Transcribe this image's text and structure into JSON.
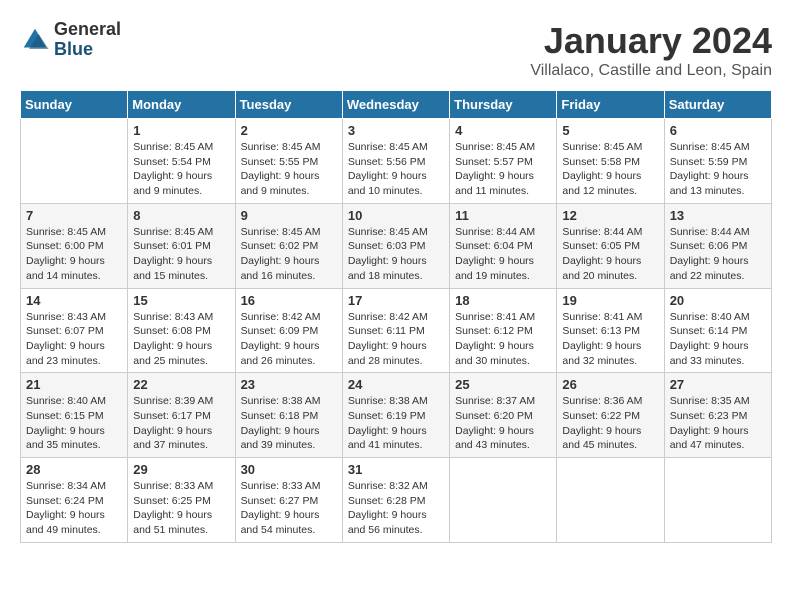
{
  "logo": {
    "general": "General",
    "blue": "Blue"
  },
  "title": "January 2024",
  "subtitle": "Villalaco, Castille and Leon, Spain",
  "days_of_week": [
    "Sunday",
    "Monday",
    "Tuesday",
    "Wednesday",
    "Thursday",
    "Friday",
    "Saturday"
  ],
  "weeks": [
    [
      {
        "day": "",
        "sunrise": "",
        "sunset": "",
        "daylight": ""
      },
      {
        "day": "1",
        "sunrise": "Sunrise: 8:45 AM",
        "sunset": "Sunset: 5:54 PM",
        "daylight": "Daylight: 9 hours and 9 minutes."
      },
      {
        "day": "2",
        "sunrise": "Sunrise: 8:45 AM",
        "sunset": "Sunset: 5:55 PM",
        "daylight": "Daylight: 9 hours and 9 minutes."
      },
      {
        "day": "3",
        "sunrise": "Sunrise: 8:45 AM",
        "sunset": "Sunset: 5:56 PM",
        "daylight": "Daylight: 9 hours and 10 minutes."
      },
      {
        "day": "4",
        "sunrise": "Sunrise: 8:45 AM",
        "sunset": "Sunset: 5:57 PM",
        "daylight": "Daylight: 9 hours and 11 minutes."
      },
      {
        "day": "5",
        "sunrise": "Sunrise: 8:45 AM",
        "sunset": "Sunset: 5:58 PM",
        "daylight": "Daylight: 9 hours and 12 minutes."
      },
      {
        "day": "6",
        "sunrise": "Sunrise: 8:45 AM",
        "sunset": "Sunset: 5:59 PM",
        "daylight": "Daylight: 9 hours and 13 minutes."
      }
    ],
    [
      {
        "day": "7",
        "sunrise": "Sunrise: 8:45 AM",
        "sunset": "Sunset: 6:00 PM",
        "daylight": "Daylight: 9 hours and 14 minutes."
      },
      {
        "day": "8",
        "sunrise": "Sunrise: 8:45 AM",
        "sunset": "Sunset: 6:01 PM",
        "daylight": "Daylight: 9 hours and 15 minutes."
      },
      {
        "day": "9",
        "sunrise": "Sunrise: 8:45 AM",
        "sunset": "Sunset: 6:02 PM",
        "daylight": "Daylight: 9 hours and 16 minutes."
      },
      {
        "day": "10",
        "sunrise": "Sunrise: 8:45 AM",
        "sunset": "Sunset: 6:03 PM",
        "daylight": "Daylight: 9 hours and 18 minutes."
      },
      {
        "day": "11",
        "sunrise": "Sunrise: 8:44 AM",
        "sunset": "Sunset: 6:04 PM",
        "daylight": "Daylight: 9 hours and 19 minutes."
      },
      {
        "day": "12",
        "sunrise": "Sunrise: 8:44 AM",
        "sunset": "Sunset: 6:05 PM",
        "daylight": "Daylight: 9 hours and 20 minutes."
      },
      {
        "day": "13",
        "sunrise": "Sunrise: 8:44 AM",
        "sunset": "Sunset: 6:06 PM",
        "daylight": "Daylight: 9 hours and 22 minutes."
      }
    ],
    [
      {
        "day": "14",
        "sunrise": "Sunrise: 8:43 AM",
        "sunset": "Sunset: 6:07 PM",
        "daylight": "Daylight: 9 hours and 23 minutes."
      },
      {
        "day": "15",
        "sunrise": "Sunrise: 8:43 AM",
        "sunset": "Sunset: 6:08 PM",
        "daylight": "Daylight: 9 hours and 25 minutes."
      },
      {
        "day": "16",
        "sunrise": "Sunrise: 8:42 AM",
        "sunset": "Sunset: 6:09 PM",
        "daylight": "Daylight: 9 hours and 26 minutes."
      },
      {
        "day": "17",
        "sunrise": "Sunrise: 8:42 AM",
        "sunset": "Sunset: 6:11 PM",
        "daylight": "Daylight: 9 hours and 28 minutes."
      },
      {
        "day": "18",
        "sunrise": "Sunrise: 8:41 AM",
        "sunset": "Sunset: 6:12 PM",
        "daylight": "Daylight: 9 hours and 30 minutes."
      },
      {
        "day": "19",
        "sunrise": "Sunrise: 8:41 AM",
        "sunset": "Sunset: 6:13 PM",
        "daylight": "Daylight: 9 hours and 32 minutes."
      },
      {
        "day": "20",
        "sunrise": "Sunrise: 8:40 AM",
        "sunset": "Sunset: 6:14 PM",
        "daylight": "Daylight: 9 hours and 33 minutes."
      }
    ],
    [
      {
        "day": "21",
        "sunrise": "Sunrise: 8:40 AM",
        "sunset": "Sunset: 6:15 PM",
        "daylight": "Daylight: 9 hours and 35 minutes."
      },
      {
        "day": "22",
        "sunrise": "Sunrise: 8:39 AM",
        "sunset": "Sunset: 6:17 PM",
        "daylight": "Daylight: 9 hours and 37 minutes."
      },
      {
        "day": "23",
        "sunrise": "Sunrise: 8:38 AM",
        "sunset": "Sunset: 6:18 PM",
        "daylight": "Daylight: 9 hours and 39 minutes."
      },
      {
        "day": "24",
        "sunrise": "Sunrise: 8:38 AM",
        "sunset": "Sunset: 6:19 PM",
        "daylight": "Daylight: 9 hours and 41 minutes."
      },
      {
        "day": "25",
        "sunrise": "Sunrise: 8:37 AM",
        "sunset": "Sunset: 6:20 PM",
        "daylight": "Daylight: 9 hours and 43 minutes."
      },
      {
        "day": "26",
        "sunrise": "Sunrise: 8:36 AM",
        "sunset": "Sunset: 6:22 PM",
        "daylight": "Daylight: 9 hours and 45 minutes."
      },
      {
        "day": "27",
        "sunrise": "Sunrise: 8:35 AM",
        "sunset": "Sunset: 6:23 PM",
        "daylight": "Daylight: 9 hours and 47 minutes."
      }
    ],
    [
      {
        "day": "28",
        "sunrise": "Sunrise: 8:34 AM",
        "sunset": "Sunset: 6:24 PM",
        "daylight": "Daylight: 9 hours and 49 minutes."
      },
      {
        "day": "29",
        "sunrise": "Sunrise: 8:33 AM",
        "sunset": "Sunset: 6:25 PM",
        "daylight": "Daylight: 9 hours and 51 minutes."
      },
      {
        "day": "30",
        "sunrise": "Sunrise: 8:33 AM",
        "sunset": "Sunset: 6:27 PM",
        "daylight": "Daylight: 9 hours and 54 minutes."
      },
      {
        "day": "31",
        "sunrise": "Sunrise: 8:32 AM",
        "sunset": "Sunset: 6:28 PM",
        "daylight": "Daylight: 9 hours and 56 minutes."
      },
      {
        "day": "",
        "sunrise": "",
        "sunset": "",
        "daylight": ""
      },
      {
        "day": "",
        "sunrise": "",
        "sunset": "",
        "daylight": ""
      },
      {
        "day": "",
        "sunrise": "",
        "sunset": "",
        "daylight": ""
      }
    ]
  ]
}
